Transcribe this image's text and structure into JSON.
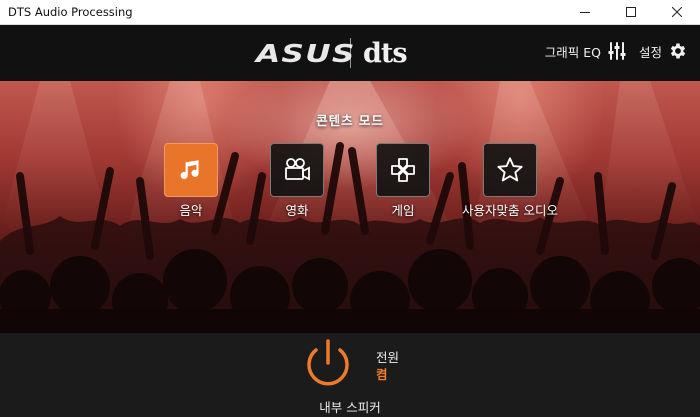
{
  "window": {
    "title": "DTS Audio Processing",
    "controls": [
      "minimize",
      "maximize",
      "close"
    ]
  },
  "header": {
    "logo_asus": "ASUS",
    "logo_dts": "dts",
    "graphic_eq_label": "그래픽 EQ",
    "settings_label": "설정",
    "icons": {
      "eq": "equalizer-icon",
      "settings": "gear-icon"
    }
  },
  "content_modes": {
    "title": "콘텐츠 모드",
    "items": [
      {
        "label": "음악",
        "icon": "music-note-icon",
        "active": true
      },
      {
        "label": "영화",
        "icon": "movie-camera-icon",
        "active": false
      },
      {
        "label": "게임",
        "icon": "gamepad-icon",
        "active": false
      },
      {
        "label": "사용자맞춤 오디오",
        "icon": "star-icon",
        "active": false
      }
    ]
  },
  "power": {
    "title": "전원",
    "state": "켬",
    "device": "내부 스피커"
  },
  "colors": {
    "accent": "#e8752a",
    "header_bg": "#111111",
    "panel_bg": "#1b1b1b"
  }
}
